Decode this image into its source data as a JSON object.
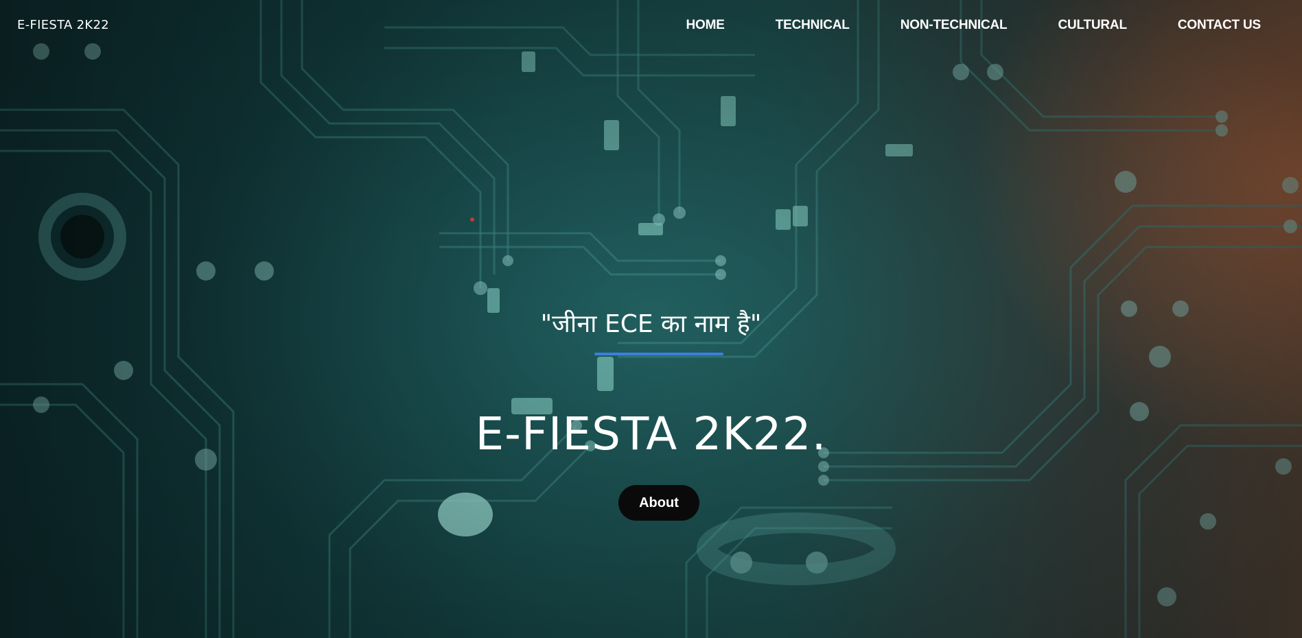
{
  "navbar": {
    "brand": "E-FIESTA 2K22",
    "links": [
      {
        "label": "HOME"
      },
      {
        "label": "TECHNICAL"
      },
      {
        "label": "NON-TECHNICAL"
      },
      {
        "label": "CULTURAL"
      },
      {
        "label": "CONTACT US"
      }
    ]
  },
  "hero": {
    "tagline": "\"जीना ECE का नाम है\"",
    "title": "E-FIESTA 2K22.",
    "about_label": "About",
    "accent_color": "#3b7fe0",
    "button_color": "#0a0a0a",
    "background": "circuit-board-image"
  }
}
